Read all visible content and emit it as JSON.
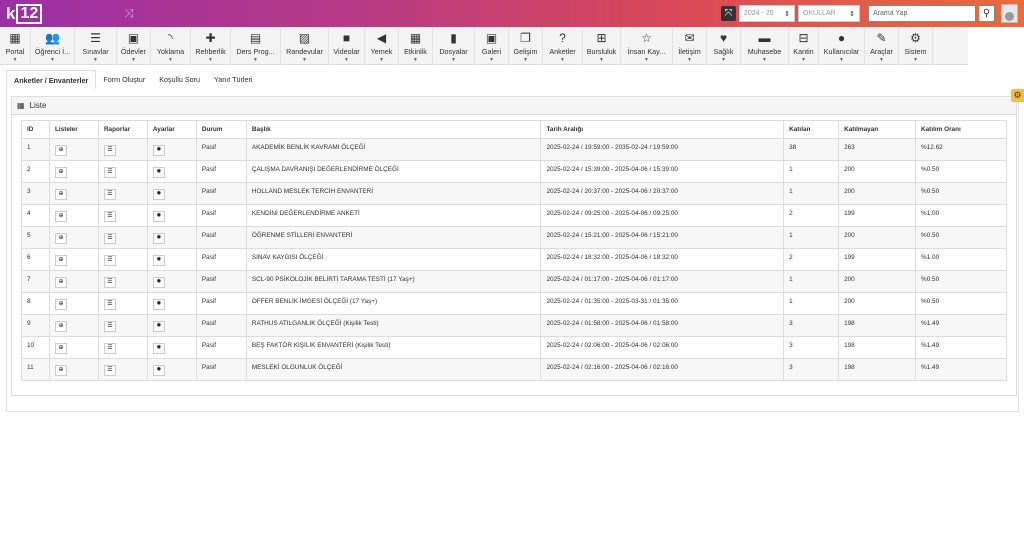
{
  "header": {
    "logo_k": "k",
    "logo_box": "12",
    "year_select": "2024 - 20",
    "school_select": "OKULLAR",
    "search_placeholder": "Arama Yap"
  },
  "menu": [
    {
      "label": "Portal",
      "icon": "grid-icon",
      "glyph": "▦"
    },
    {
      "label": "Öğrenci İ...",
      "icon": "users-icon",
      "glyph": "👥"
    },
    {
      "label": "Sınavlar",
      "icon": "list-indent-icon",
      "glyph": "☰"
    },
    {
      "label": "Ödevler",
      "icon": "picture-frame-icon",
      "glyph": "▣"
    },
    {
      "label": "Yoklama",
      "icon": "rss-icon",
      "glyph": "◝"
    },
    {
      "label": "Rehberlik",
      "icon": "puzzle-icon",
      "glyph": "✚"
    },
    {
      "label": "Ders Prog...",
      "icon": "table-icon",
      "glyph": "▤"
    },
    {
      "label": "Randevular",
      "icon": "calendar-check-icon",
      "glyph": "▨"
    },
    {
      "label": "Videolar",
      "icon": "video-camera-icon",
      "glyph": "■"
    },
    {
      "label": "Yemek",
      "icon": "volume-icon",
      "glyph": "◀"
    },
    {
      "label": "Etkinlik",
      "icon": "calendar-icon",
      "glyph": "▦"
    },
    {
      "label": "Dosyalar",
      "icon": "file-icon",
      "glyph": "▮"
    },
    {
      "label": "Galeri",
      "icon": "image-icon",
      "glyph": "▣"
    },
    {
      "label": "Gelişim",
      "icon": "copy-icon",
      "glyph": "❐"
    },
    {
      "label": "Anketler",
      "icon": "question-icon",
      "glyph": "?"
    },
    {
      "label": "Bursluluk",
      "icon": "sitemap-icon",
      "glyph": "⊞"
    },
    {
      "label": "İnsan Kay...",
      "icon": "star-icon",
      "glyph": "☆"
    },
    {
      "label": "İletişim",
      "icon": "envelope-icon",
      "glyph": "✉"
    },
    {
      "label": "Sağlık",
      "icon": "heartbeat-icon",
      "glyph": "♥"
    },
    {
      "label": "Muhasebe",
      "icon": "credit-card-icon",
      "glyph": "▬"
    },
    {
      "label": "Kantin",
      "icon": "basket-icon",
      "glyph": "⊟"
    },
    {
      "label": "Kullanıcılar",
      "icon": "user-icon",
      "glyph": "●"
    },
    {
      "label": "Araçlar",
      "icon": "wrench-icon",
      "glyph": "✎"
    },
    {
      "label": "Sistem",
      "icon": "gears-icon",
      "glyph": "⚙"
    }
  ],
  "tabs": [
    "Anketler / Envanterler",
    "Form Oluştur",
    "Koşullu Soru",
    "Yanıt Türleri"
  ],
  "panel": {
    "title": "Liste"
  },
  "table": {
    "headers": [
      "ID",
      "Listeler",
      "Raporlar",
      "Ayarlar",
      "Durum",
      "Başlık",
      "Tarih Aralığı",
      "Katılan",
      "Katılmayan",
      "Katılım Oranı"
    ],
    "rows": [
      {
        "id": "1",
        "status": "Pasif",
        "title": "AKADEMİK BENLİK KAVRAMI ÖLÇEĞİ",
        "date": "2025-02-24 / 19:59:00 - 2035-02-24 / 19:59:00",
        "joined": "38",
        "not_joined": "263",
        "rate": "%12.62"
      },
      {
        "id": "2",
        "status": "Pasif",
        "title": "ÇALIŞMA DAVRANIŞI DEĞERLENDİRME ÖLÇEĞİ",
        "date": "2025-02-24 / 15:39:00 - 2025-04-06 / 15:39:00",
        "joined": "1",
        "not_joined": "200",
        "rate": "%0.50"
      },
      {
        "id": "3",
        "status": "Pasif",
        "title": "HOLLAND MESLEK TERCİH ENVANTERİ",
        "date": "2025-02-24 / 20:37:00 - 2025-04-06 / 20:37:00",
        "joined": "1",
        "not_joined": "200",
        "rate": "%0.50"
      },
      {
        "id": "4",
        "status": "Pasif",
        "title": "KENDİNİ DEĞERLENDİRME ANKETİ",
        "date": "2025-02-24 / 09:25:00 - 2025-04-06 / 09:25:00",
        "joined": "2",
        "not_joined": "199",
        "rate": "%1.00"
      },
      {
        "id": "5",
        "status": "Pasif",
        "title": "ÖĞRENME STİLLERİ ENVANTERİ",
        "date": "2025-02-24 / 15:21:00 - 2025-04-06 / 15:21:00",
        "joined": "1",
        "not_joined": "200",
        "rate": "%0.50"
      },
      {
        "id": "6",
        "status": "Pasif",
        "title": "SINAV KAYGISI ÖLÇEĞİ",
        "date": "2025-02-24 / 18:32:00 - 2025-04-06 / 18:32:00",
        "joined": "2",
        "not_joined": "199",
        "rate": "%1.00"
      },
      {
        "id": "7",
        "status": "Pasif",
        "title": "SCL-90 PSİKOLOJİK BELİRTİ TARAMA TESTİ (17 Yaş+)",
        "date": "2025-02-24 / 01:17:00 - 2025-04-06 / 01:17:00",
        "joined": "1",
        "not_joined": "200",
        "rate": "%0.50"
      },
      {
        "id": "8",
        "status": "Pasif",
        "title": "OFFER BENLİK İMGESİ ÖLÇEĞİ (17 Yaş+)",
        "date": "2025-02-24 / 01:35:00 - 2025-03-31 / 01:35:00",
        "joined": "1",
        "not_joined": "200",
        "rate": "%0.50"
      },
      {
        "id": "9",
        "status": "Pasif",
        "title": "RATHUS ATILGANLIK ÖLÇEĞİ (Kişilik Testi)",
        "date": "2025-02-24 / 01:58:00 - 2025-04-06 / 01:58:00",
        "joined": "3",
        "not_joined": "198",
        "rate": "%1.49"
      },
      {
        "id": "10",
        "status": "Pasif",
        "title": "BEŞ FAKTÖR KİŞİLİK ENVANTERİ (Kişilik Testi)",
        "date": "2025-02-24 / 02:06:00 - 2025-04-06 / 02:06:00",
        "joined": "3",
        "not_joined": "198",
        "rate": "%1.49"
      },
      {
        "id": "11",
        "status": "Pasif",
        "title": "MESLEKİ OLGUNLUK ÖLÇEĞİ",
        "date": "2025-02-24 / 02:16:00 - 2025-04-06 / 02:16:00",
        "joined": "3",
        "not_joined": "198",
        "rate": "%1.49"
      }
    ]
  }
}
